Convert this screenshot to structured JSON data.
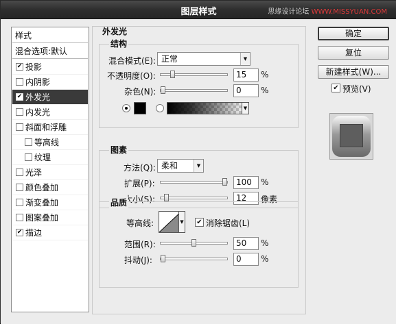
{
  "window": {
    "title": "图层样式",
    "watermark_prefix": "思缘设计论坛",
    "watermark_site": "WWW.MISSYUAN.COM"
  },
  "left_list": {
    "header": "样式",
    "blend": "混合选项:默认",
    "items": [
      {
        "label": "投影",
        "checked": true,
        "selected": false,
        "indent": false
      },
      {
        "label": "内阴影",
        "checked": false,
        "selected": false,
        "indent": false
      },
      {
        "label": "外发光",
        "checked": true,
        "selected": true,
        "indent": false
      },
      {
        "label": "内发光",
        "checked": false,
        "selected": false,
        "indent": false
      },
      {
        "label": "斜面和浮雕",
        "checked": false,
        "selected": false,
        "indent": false
      },
      {
        "label": "等高线",
        "checked": false,
        "selected": false,
        "indent": true
      },
      {
        "label": "纹理",
        "checked": false,
        "selected": false,
        "indent": true
      },
      {
        "label": "光泽",
        "checked": false,
        "selected": false,
        "indent": false
      },
      {
        "label": "颜色叠加",
        "checked": false,
        "selected": false,
        "indent": false
      },
      {
        "label": "渐变叠加",
        "checked": false,
        "selected": false,
        "indent": false
      },
      {
        "label": "图案叠加",
        "checked": false,
        "selected": false,
        "indent": false
      },
      {
        "label": "描边",
        "checked": true,
        "selected": false,
        "indent": false
      }
    ]
  },
  "outer_glow": {
    "title": "外发光",
    "structure": {
      "title": "结构",
      "blend_mode_label": "混合模式(E):",
      "blend_mode_value": "正常",
      "opacity_label": "不透明度(O):",
      "opacity_value": "15",
      "opacity_fraction": 0.15,
      "noise_label": "杂色(N):",
      "noise_value": "0",
      "noise_fraction": 0.0,
      "unit_percent": "%",
      "color": "#000000"
    },
    "elements": {
      "title": "图素",
      "technique_label": "方法(Q):",
      "technique_value": "柔和",
      "spread_label": "扩展(P):",
      "spread_value": "100",
      "spread_fraction": 1.0,
      "size_label": "大小(S):",
      "size_value": "12",
      "size_fraction": 0.05,
      "unit_px": "像素"
    },
    "quality": {
      "title": "品质",
      "contour_label": "等高线:",
      "anti_alias_label": "消除锯齿(L)",
      "anti_alias_checked": true,
      "range_label": "范围(R):",
      "range_value": "50",
      "range_fraction": 0.5,
      "jitter_label": "抖动(J):",
      "jitter_value": "0",
      "jitter_fraction": 0.0
    }
  },
  "buttons": {
    "ok": "确定",
    "reset": "复位",
    "new_style": "新建样式(W)...",
    "preview_label": "预览(V)",
    "preview_checked": true
  }
}
